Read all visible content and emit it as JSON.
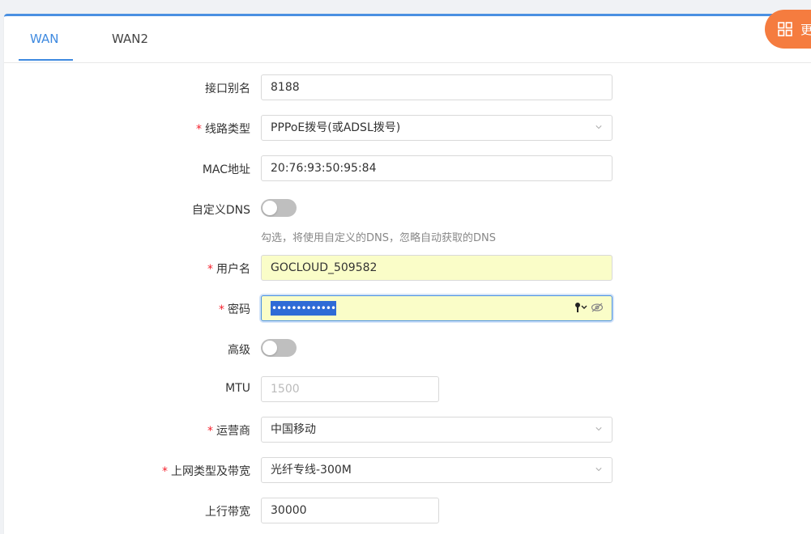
{
  "tabs": [
    {
      "label": "WAN",
      "active": true
    },
    {
      "label": "WAN2",
      "active": false
    }
  ],
  "float_button": {
    "label": "更",
    "icon": "grid-icon"
  },
  "form": {
    "alias": {
      "label": "接口别名",
      "value": "8188"
    },
    "line_type": {
      "label": "线路类型",
      "value": "PPPoE拨号(或ADSL拨号)",
      "required": true
    },
    "mac": {
      "label": "MAC地址",
      "value": "20:76:93:50:95:84"
    },
    "custom_dns": {
      "label": "自定义DNS",
      "on": false,
      "hint": "勾选，将使用自定义的DNS，忽略自动获取的DNS"
    },
    "username": {
      "label": "用户名",
      "value": "GOCLOUD_509582",
      "required": true
    },
    "password": {
      "label": "密码",
      "masked": "•••••••••••••",
      "required": true,
      "icons": [
        "key-icon",
        "eye-off-icon"
      ]
    },
    "advanced": {
      "label": "高级",
      "on": false
    },
    "mtu": {
      "label": "MTU",
      "placeholder": "1500"
    },
    "isp": {
      "label": "运营商",
      "value": "中国移动",
      "required": true
    },
    "net_type": {
      "label": "上网类型及带宽",
      "value": "光纤专线-300M",
      "required": true
    },
    "upstream": {
      "label": "上行带宽",
      "value": "30000"
    }
  },
  "colors": {
    "accent": "#3f8ae0",
    "float": "#f57c3f",
    "autofill": "#fafdc8",
    "required": "#f5222d"
  }
}
